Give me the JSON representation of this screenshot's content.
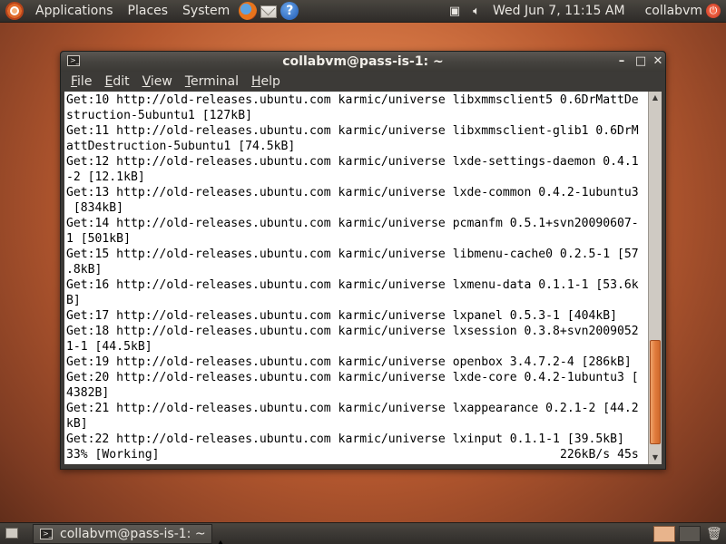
{
  "top_panel": {
    "menus": [
      "Applications",
      "Places",
      "System"
    ],
    "clock": "Wed Jun  7, 11:15 AM",
    "user": "collabvm"
  },
  "window": {
    "title": "collabvm@pass-is-1: ~",
    "menus": [
      "File",
      "Edit",
      "View",
      "Terminal",
      "Help"
    ],
    "scroll_position": 0.97,
    "scroll_visible_fraction": 0.3
  },
  "terminal": {
    "lines": [
      "Get:10 http://old-releases.ubuntu.com karmic/universe libxmmsclient5 0.6DrMattDe",
      "struction-5ubuntu1 [127kB]",
      "Get:11 http://old-releases.ubuntu.com karmic/universe libxmmsclient-glib1 0.6DrM",
      "attDestruction-5ubuntu1 [74.5kB]",
      "Get:12 http://old-releases.ubuntu.com karmic/universe lxde-settings-daemon 0.4.1",
      "-2 [12.1kB]",
      "Get:13 http://old-releases.ubuntu.com karmic/universe lxde-common 0.4.2-1ubuntu3",
      " [834kB]",
      "Get:14 http://old-releases.ubuntu.com karmic/universe pcmanfm 0.5.1+svn20090607-",
      "1 [501kB]",
      "Get:15 http://old-releases.ubuntu.com karmic/universe libmenu-cache0 0.2.5-1 [57",
      ".8kB]",
      "Get:16 http://old-releases.ubuntu.com karmic/universe lxmenu-data 0.1.1-1 [53.6k",
      "B]",
      "Get:17 http://old-releases.ubuntu.com karmic/universe lxpanel 0.5.3-1 [404kB]",
      "Get:18 http://old-releases.ubuntu.com karmic/universe lxsession 0.3.8+svn2009052",
      "1-1 [44.5kB]",
      "Get:19 http://old-releases.ubuntu.com karmic/universe openbox 3.4.7.2-4 [286kB]",
      "Get:20 http://old-releases.ubuntu.com karmic/universe lxde-core 0.4.2-1ubuntu3 [",
      "4382B]",
      "Get:21 http://old-releases.ubuntu.com karmic/universe lxappearance 0.2.1-2 [44.2",
      "kB]",
      "Get:22 http://old-releases.ubuntu.com karmic/universe lxinput 0.1.1-1 [39.5kB]"
    ],
    "status_left": "33% [Working]",
    "status_right": "226kB/s 45s"
  },
  "bottom_panel": {
    "task_label": "collabvm@pass-is-1: ~"
  }
}
